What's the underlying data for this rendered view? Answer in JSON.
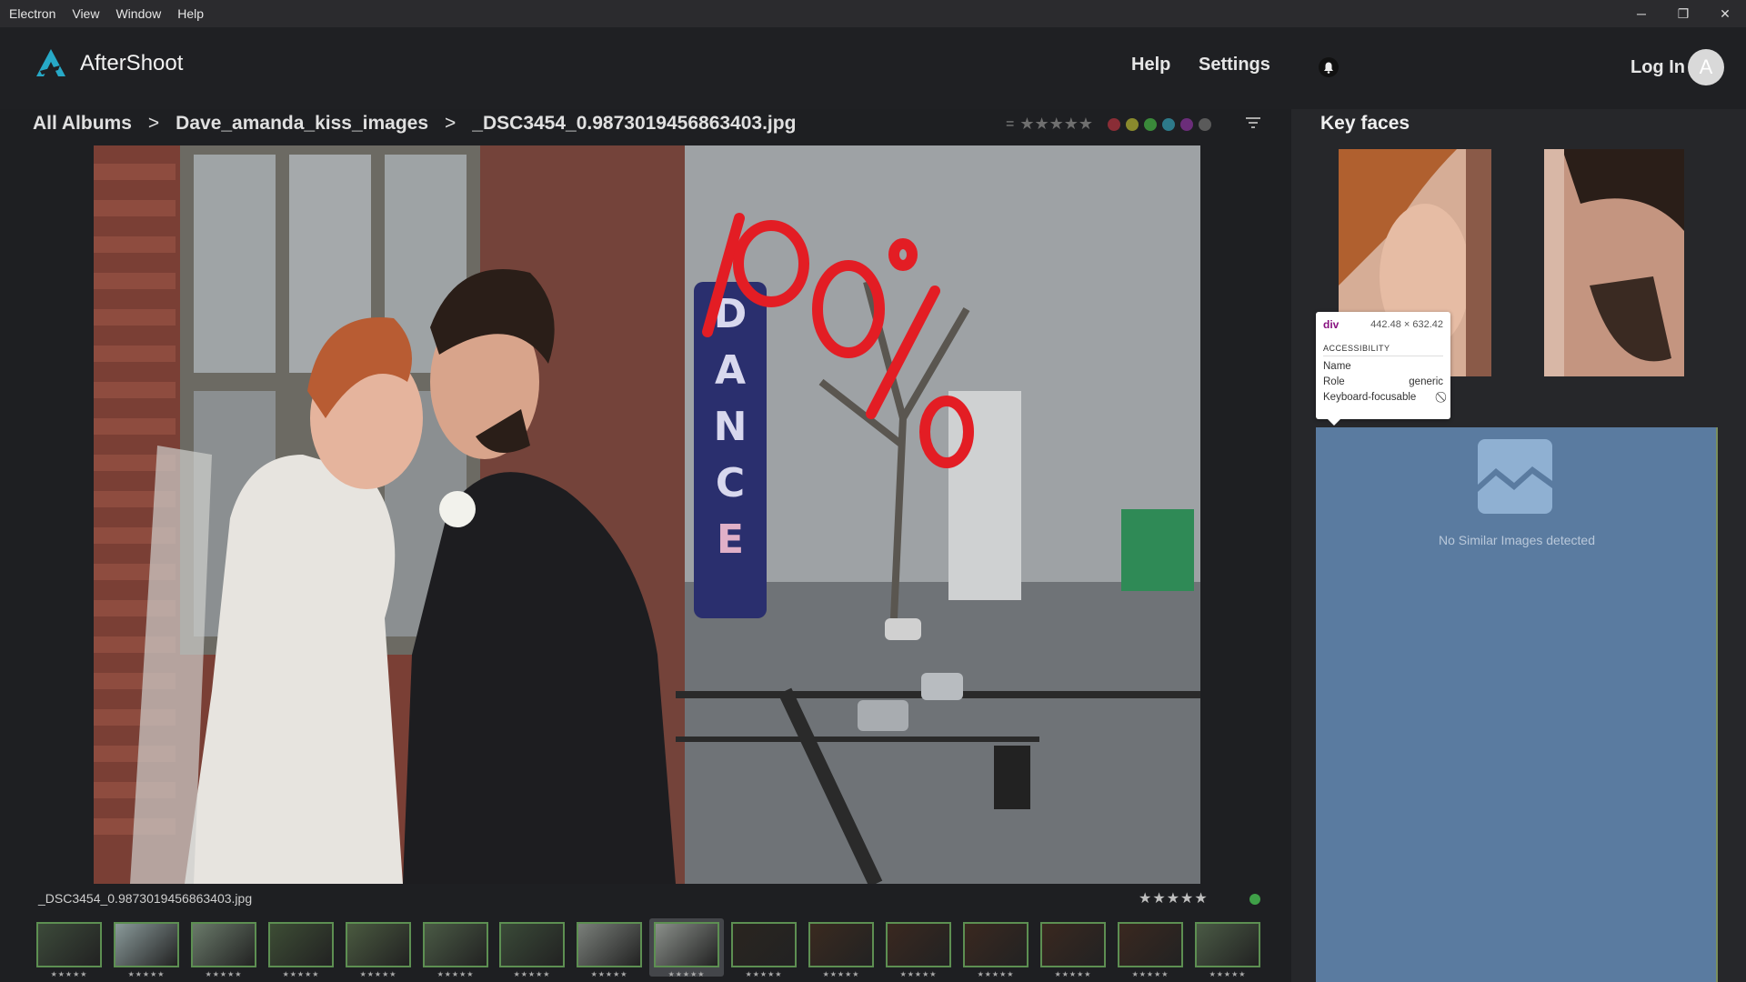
{
  "os_menu": [
    "Electron",
    "View",
    "Window",
    "Help"
  ],
  "window_controls": {
    "minimize": "─",
    "restore": "❐",
    "close": "✕"
  },
  "app": {
    "name": "AfterShoot",
    "brand_color": "#27a9c7"
  },
  "nav": {
    "help": "Help",
    "settings": "Settings",
    "login": "Log In",
    "avatar_letter": "A"
  },
  "breadcrumb": {
    "items": [
      "All Albums",
      "Dave_amanda_kiss_images",
      "_DSC3454_0.9873019456863403.jpg"
    ],
    "separator": ">"
  },
  "filter": {
    "eq": "=",
    "stars": "★★★★★",
    "colors": [
      "#8a2d36",
      "#8a8a2d",
      "#3a8a3a",
      "#2d7a8a",
      "#6b2d7a",
      "#5a5a5a"
    ]
  },
  "image": {
    "annotation": "100%"
  },
  "current_file": {
    "name": "_DSC3454_0.9873019456863403.jpg",
    "stars": "★★★★★",
    "status_color": "#3fa048"
  },
  "filmstrip": {
    "selected_index": 8,
    "thumb_stars": "★★★★★",
    "thumbs": [
      {
        "bg": "#3c4a3a"
      },
      {
        "bg": "#8a9a9a"
      },
      {
        "bg": "#6a7a6a"
      },
      {
        "bg": "#3d4d35"
      },
      {
        "bg": "#4a5a40"
      },
      {
        "bg": "#4a5a45"
      },
      {
        "bg": "#3a4a38"
      },
      {
        "bg": "#7a7f7a"
      },
      {
        "bg": "#8a8f8a"
      },
      {
        "bg": "#2a2520"
      },
      {
        "bg": "#3a2a20"
      },
      {
        "bg": "#3a2820"
      },
      {
        "bg": "#3a2820"
      },
      {
        "bg": "#3a2820"
      },
      {
        "bg": "#3a2820"
      },
      {
        "bg": "#4a5a45"
      }
    ]
  },
  "key_faces": {
    "title": "Key faces"
  },
  "similar": {
    "empty_text": "No Similar Images detected"
  },
  "tooltip": {
    "tag": "div",
    "dims": "442.48 × 632.42",
    "section": "ACCESSIBILITY",
    "rows": [
      {
        "label": "Name",
        "value": ""
      },
      {
        "label": "Role",
        "value": "generic"
      },
      {
        "label": "Keyboard-focusable",
        "value": "⃠"
      }
    ]
  }
}
